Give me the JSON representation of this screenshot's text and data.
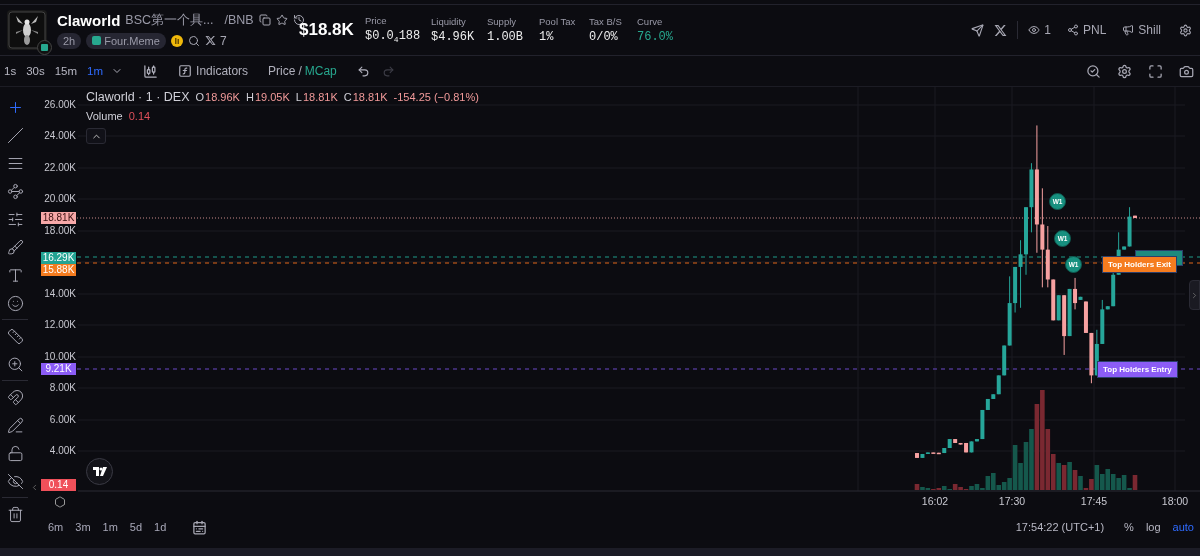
{
  "token": {
    "name": "Claworld",
    "description": "BSC第一个具...",
    "pair": "/BNB",
    "age": "2h",
    "platform": "Four.Meme",
    "x_count": "7",
    "market_cap": "$18.8K"
  },
  "stats": [
    {
      "label": "Price",
      "value": "$0.0$_{4}$188",
      "kind": "plain"
    },
    {
      "label": "Liquidity",
      "value": "$4.96K",
      "kind": "plain"
    },
    {
      "label": "Supply",
      "value": "1.00B",
      "kind": "plain"
    },
    {
      "label": "Pool Tax",
      "value": "1%",
      "kind": "plain"
    },
    {
      "label": "Tax B/S",
      "value": "0/0%",
      "kind": "plain"
    },
    {
      "label": "Curve",
      "value": "76.0%",
      "kind": "accent"
    }
  ],
  "header_actions": {
    "watchers": "1",
    "pnl": "PNL",
    "shill": "Shill"
  },
  "intervals": [
    {
      "label": "1s",
      "selected": false
    },
    {
      "label": "30s",
      "selected": false
    },
    {
      "label": "15m",
      "selected": false
    },
    {
      "label": "1m",
      "selected": true
    }
  ],
  "indicators": "Indicators",
  "price_mode": [
    {
      "label": "Price",
      "selected": false
    },
    {
      "label": "MCap",
      "selected": true
    }
  ],
  "price_mode_separator": "/",
  "undo": {
    "disabled": false
  },
  "redo": {
    "disabled": true
  },
  "drawing_tools": [
    [
      {
        "selected": true
      },
      {
        "selected": false
      },
      {
        "selected": false
      },
      {
        "selected": false
      },
      {
        "selected": false
      },
      {
        "selected": false
      },
      {
        "selected": false
      },
      {
        "selected": false
      }
    ],
    [
      {
        "selected": false
      },
      {
        "selected": false
      }
    ],
    [
      {
        "selected": false
      },
      {
        "selected": false
      },
      {
        "selected": false
      },
      {
        "selected": false
      }
    ],
    [
      {
        "selected": false
      }
    ]
  ],
  "legend": {
    "symbol": "Claworld · 1 · DEX",
    "ohlc": [
      {
        "label": "O",
        "value": "18.96K"
      },
      {
        "label": "H",
        "value": "19.05K"
      },
      {
        "label": "L",
        "value": "18.81K"
      },
      {
        "label": "C",
        "value": "18.81K"
      }
    ],
    "change": "-154.25 (−0.81%)",
    "volume_label": "Volume",
    "volume_value": "0.14"
  },
  "y_ticks": [
    "26.00K",
    "24.00K",
    "22.00K",
    "20.00K",
    "18.00K",
    "14.00K",
    "12.00K",
    "10.00K",
    "8.00K",
    "6.00K",
    "4.00K"
  ],
  "price_labels": [
    {
      "text": "18.81K",
      "color": "#f7a8a8"
    },
    {
      "text": "16.29K",
      "color": "#22a393"
    },
    {
      "text": "15.88K",
      "color": "#f57c1f"
    },
    {
      "text": "9.21K",
      "color": "#8b5cf6"
    },
    {
      "text": "0.14",
      "color": "#f0505a"
    }
  ],
  "markers": [
    {
      "text": "W1"
    },
    {
      "text": "W1"
    },
    {
      "text": "W1"
    }
  ],
  "holder_labels": [
    {
      "text": "Top Holders Exit",
      "color": "#f57c1f"
    },
    {
      "text": "Top Holders Entry",
      "color": "#8b5cf6"
    }
  ],
  "time_ticks": [
    "16:02",
    "17:30",
    "17:45",
    "18:00"
  ],
  "ranges": [
    "6m",
    "3m",
    "1m",
    "5d",
    "1d"
  ],
  "clock": "17:54:22 (UTC+1)",
  "scale_options": [
    {
      "label": "%",
      "selected": false
    },
    {
      "label": "log",
      "selected": false
    },
    {
      "label": "auto",
      "selected": true
    }
  ]
}
